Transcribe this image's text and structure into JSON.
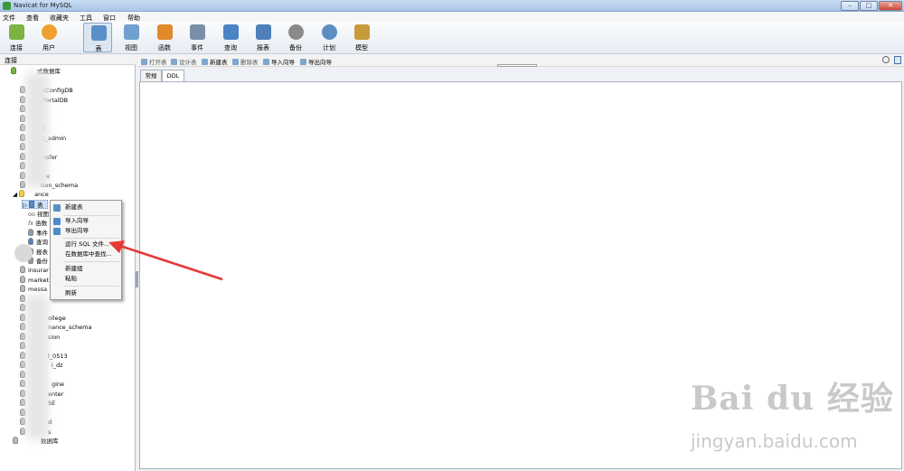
{
  "window": {
    "title": "Navicat for MySQL",
    "minimize": "–",
    "maximize": "□",
    "close": "✕"
  },
  "menu": [
    "文件",
    "查看",
    "收藏夹",
    "工具",
    "窗口",
    "帮助"
  ],
  "toolbar": [
    {
      "label": "连接",
      "icon": "plug-icon",
      "color": "#7cb342"
    },
    {
      "label": "用户",
      "icon": "user-icon",
      "color": "#f0a030"
    },
    {
      "label": "表",
      "icon": "table-icon",
      "color": "#5a8fc7",
      "active": true
    },
    {
      "label": "视图",
      "icon": "view-icon",
      "color": "#6fa0d0"
    },
    {
      "label": "函数",
      "icon": "function-icon",
      "color": "#e08a2a"
    },
    {
      "label": "事件",
      "icon": "event-icon",
      "color": "#7a8ea8"
    },
    {
      "label": "查询",
      "icon": "query-icon",
      "color": "#4a84c4"
    },
    {
      "label": "报表",
      "icon": "report-icon",
      "color": "#4f7fb8"
    },
    {
      "label": "备份",
      "icon": "backup-icon",
      "color": "#8a8a8a"
    },
    {
      "label": "计划",
      "icon": "schedule-icon",
      "color": "#5c8ec4"
    },
    {
      "label": "模型",
      "icon": "model-icon",
      "color": "#c79a3a"
    }
  ],
  "conn_header": "连接",
  "tree": {
    "root_label": "式数据库",
    "items": [
      "sConfigDB",
      "PortalDB",
      "",
      "t",
      "t_admin",
      "",
      "nsfer",
      "",
      "e",
      "tion_schema"
    ],
    "expanded_db": "ance",
    "table_node": "表",
    "children": [
      "视图",
      "函数",
      "事件",
      "查询",
      "报表",
      "备份"
    ],
    "items2": [
      "insurar",
      "market",
      "messa",
      "",
      "",
      "ollege",
      "nance_schema",
      "sion",
      "",
      "l_0513",
      "i_dz",
      "",
      "gine",
      "enter",
      "SE",
      "",
      "d",
      "s"
    ],
    "bottom_label": "数据库"
  },
  "object_toolbar": [
    "打开表",
    "设计表",
    "新建表",
    "删除表",
    "导入向导",
    "导出向导"
  ],
  "tabs": [
    "常规",
    "DDL"
  ],
  "context_menu": {
    "items": [
      "新建表",
      "导入向导",
      "导出向导",
      "运行 SQL 文件...",
      "在数据库中查找...",
      "新建组",
      "粘贴",
      "刷新"
    ]
  },
  "watermark": {
    "logo": "Bai du 经验",
    "url": "jingyan.baidu.com"
  },
  "colors": {
    "arrow": "#e53935",
    "accent": "#5a8fc7"
  }
}
